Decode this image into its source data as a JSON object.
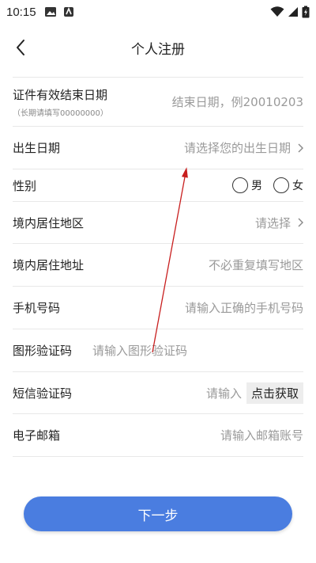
{
  "status": {
    "time": "10:15"
  },
  "header": {
    "title": "个人注册"
  },
  "form": {
    "cert_end": {
      "label": "证件有效结束日期",
      "sub": "（长期请填写00000000）",
      "placeholder": "结束日期，例20010203"
    },
    "birth": {
      "label": "出生日期",
      "placeholder": "请选择您的出生日期"
    },
    "gender": {
      "label": "性别",
      "options": [
        "男",
        "女"
      ]
    },
    "region": {
      "label": "境内居住地区",
      "placeholder": "请选择"
    },
    "address": {
      "label": "境内居住地址",
      "placeholder": "不必重复填写地区"
    },
    "phone": {
      "label": "手机号码",
      "placeholder": "请输入正确的手机号码"
    },
    "captcha": {
      "label": "图形验证码",
      "placeholder": "请输入图形验证码"
    },
    "sms": {
      "label": "短信验证码",
      "placeholder": "请输入",
      "button": "点击获取"
    },
    "email": {
      "label": "电子邮箱",
      "placeholder": "请输入邮箱账号"
    }
  },
  "actions": {
    "next": "下一步"
  },
  "colors": {
    "primary": "#4a7de0",
    "annotation": "#c81e1e"
  }
}
